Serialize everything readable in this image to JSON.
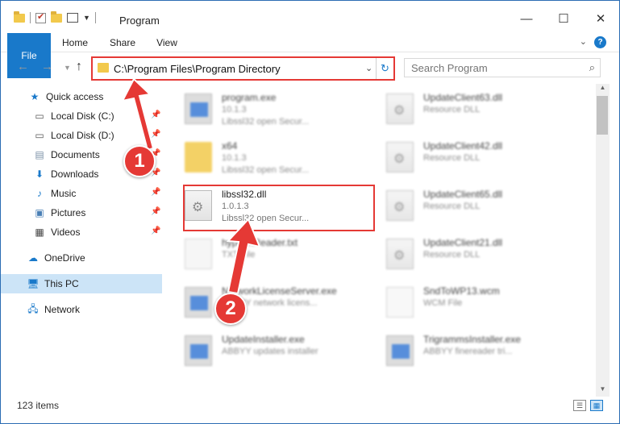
{
  "window": {
    "title": "Program"
  },
  "ribbon": {
    "tabs": [
      "File",
      "Home",
      "Share",
      "View"
    ],
    "help_label": "?"
  },
  "navbar": {
    "address": "C:\\Program Files\\Program Directory",
    "search_placeholder": "Search Program"
  },
  "sidebar": {
    "items": [
      {
        "label": "Quick access",
        "icon": "star-icon"
      },
      {
        "label": "Local Disk (C:)",
        "icon": "drive-icon",
        "pinned": true
      },
      {
        "label": "Local Disk (D:)",
        "icon": "drive-icon",
        "pinned": true
      },
      {
        "label": "Documents",
        "icon": "documents-icon",
        "pinned": true
      },
      {
        "label": "Downloads",
        "icon": "download-icon",
        "pinned": true
      },
      {
        "label": "Music",
        "icon": "music-icon",
        "pinned": true
      },
      {
        "label": "Pictures",
        "icon": "pictures-icon",
        "pinned": true
      },
      {
        "label": "Videos",
        "icon": "videos-icon",
        "pinned": true
      },
      {
        "label": "OneDrive",
        "icon": "cloud-icon"
      },
      {
        "label": "This PC",
        "icon": "computer-icon",
        "selected": true
      },
      {
        "label": "Network",
        "icon": "network-icon"
      }
    ]
  },
  "files": [
    {
      "name": "program.exe",
      "line2": "10.1.3",
      "line3": "Libssl32 open Secur...",
      "icon": "exe-icon",
      "blurred": true
    },
    {
      "name": "UpdateClient63.dll",
      "line2": "Resource DLL",
      "line3": "",
      "icon": "dll-icon",
      "blurred": true
    },
    {
      "name": "x64",
      "line2": "10.1.3",
      "line3": "Libssl32 open Secur...",
      "icon": "folder-icon",
      "blurred": true
    },
    {
      "name": "UpdateClient42.dll",
      "line2": "Resource DLL",
      "line3": "",
      "icon": "dll-icon",
      "blurred": true
    },
    {
      "name": "libssl32.dll",
      "line2": "1.0.1.3",
      "line3": "Libssl32 open Secur...",
      "icon": "dll-icon",
      "blurred": false
    },
    {
      "name": "UpdateClient65.dll",
      "line2": "Resource DLL",
      "line3": "",
      "icon": "dll-icon",
      "blurred": true
    },
    {
      "name": "hyphenReader.txt",
      "line2": "TXT File",
      "line3": "",
      "icon": "txt-icon",
      "blurred": true
    },
    {
      "name": "UpdateClient21.dll",
      "line2": "Resource DLL",
      "line3": "",
      "icon": "dll-icon",
      "blurred": true
    },
    {
      "name": "NetworkLicenseServer.exe",
      "line2": "ABBYY network licens...",
      "line3": "",
      "icon": "exe-icon",
      "blurred": true
    },
    {
      "name": "SndToWP13.wcm",
      "line2": "WCM File",
      "line3": "",
      "icon": "wcm-icon",
      "blurred": true
    },
    {
      "name": "UpdateInstaller.exe",
      "line2": "ABBYY updates installer",
      "line3": "",
      "icon": "exe-icon",
      "blurred": true
    },
    {
      "name": "TrigrammsInstaller.exe",
      "line2": "ABBYY finereader tri...",
      "line3": "",
      "icon": "exe-icon",
      "blurred": true
    }
  ],
  "status": {
    "item_count": "123 items"
  },
  "annotations": {
    "step1": "1",
    "step2": "2",
    "color": "#e53935"
  }
}
